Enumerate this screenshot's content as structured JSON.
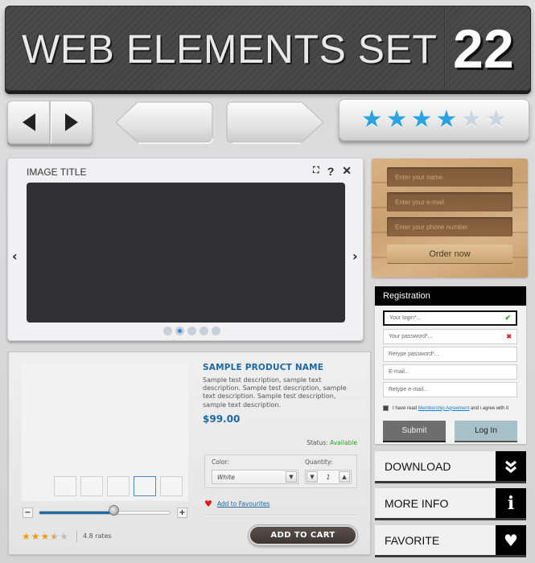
{
  "banner": {
    "title": "WEB ELEMENTS SET",
    "number": "22"
  },
  "nav_buttons": {
    "prev_icon": "triangle-left-icon",
    "next_icon": "triangle-right-icon"
  },
  "top_rating": {
    "value": 4,
    "max": 6,
    "icon": "star-icon",
    "color_on": "#2aa3e0",
    "color_off": "#c8d6e0"
  },
  "viewer": {
    "title": "IMAGE TITLE",
    "tools": {
      "fullscreen": "⛶",
      "help": "?",
      "close": "✕"
    },
    "prev": "‹",
    "next": "›",
    "dots": 5,
    "active_dot": 1
  },
  "order_form": {
    "fields": [
      {
        "placeholder": "Enter your name"
      },
      {
        "placeholder": "Enter your e-mail"
      },
      {
        "placeholder": "Enter your phone number"
      }
    ],
    "button": "Order now"
  },
  "registration": {
    "title": "Registration",
    "fields": [
      {
        "placeholder": "Your login*...",
        "status": "valid",
        "status_glyph": "✔"
      },
      {
        "placeholder": "Your password*...",
        "status": "invalid",
        "status_glyph": "✖"
      },
      {
        "placeholder": "Retype password*...",
        "status": "",
        "status_glyph": ""
      },
      {
        "placeholder": "E-mail...",
        "status": "",
        "status_glyph": ""
      },
      {
        "placeholder": "Retype e-mail...",
        "status": "",
        "status_glyph": ""
      }
    ],
    "agree": {
      "prefix": "I have read ",
      "link": "Membership Agreement",
      "suffix": " and i agree with it",
      "checked": true
    },
    "submit": "Submit",
    "login": "Log In"
  },
  "actions": [
    {
      "label": "DOWNLOAD",
      "icon": "double-chevron-down-icon",
      "glyph": "︾"
    },
    {
      "label": "MORE INFO",
      "icon": "info-icon",
      "glyph": "i"
    },
    {
      "label": "FAVORITE",
      "icon": "heart-icon",
      "glyph": "♥"
    }
  ],
  "product": {
    "name": "SAMPLE PRODUCT NAME",
    "description": "Sample test description, sample text description. Sample test description, sample text description. Sample test description, sample text description.",
    "price": "$99.00",
    "status_label": "Status: ",
    "status_value": "Available",
    "status_color": "#2aa32a",
    "color_label": "Color:",
    "color_value": "White",
    "quantity_label": "Quantity:",
    "quantity_value": "1",
    "favourites_link": "Add to Favourites",
    "add_to_cart": "ADD TO CART",
    "thumbnails": 5,
    "active_thumbnail": 3,
    "zoom_level": 0.57,
    "zoom_minus": "−",
    "zoom_plus": "+",
    "rating": 3.5,
    "rating_max": 5,
    "rates_text": "4.8 rates"
  }
}
